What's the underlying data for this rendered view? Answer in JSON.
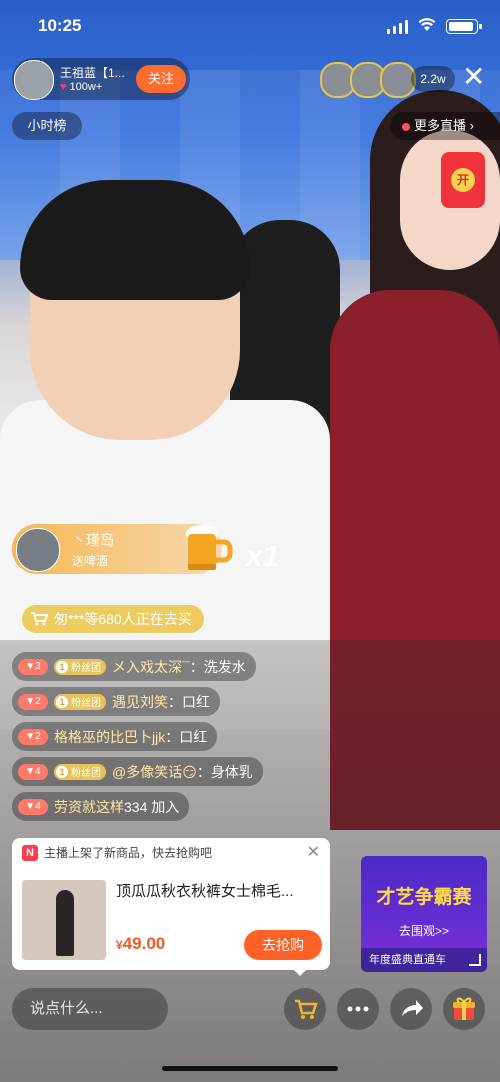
{
  "status": {
    "time": "10:25"
  },
  "host": {
    "name": "王祖蓝【1...",
    "likes": "100w+"
  },
  "follow_label": "关注",
  "viewer_count": "2.2w",
  "hour_rank": "小时榜",
  "more_live": "更多直播",
  "red_packet": "开",
  "gift": {
    "user": "丶瑾岛",
    "desc": "送啤酒",
    "count": "x1"
  },
  "buyers": "匆***等680人正在去买",
  "chat": [
    {
      "level": "3",
      "fan": "粉丝团",
      "user": "メ入戏太深¯",
      "sep": "：",
      "text": "洗发水"
    },
    {
      "level": "2",
      "fan": "粉丝团",
      "user": "遇见刘笑",
      "sep": "：",
      "text": "口红"
    },
    {
      "level": "2",
      "fan": "",
      "user": "格格巫的比巴卜jjk",
      "sep": "：",
      "text": "口红"
    },
    {
      "level": "4",
      "fan": "粉丝团",
      "user": "@多像笑话😏",
      "sep": "：",
      "text": "身体乳"
    },
    {
      "level": "4",
      "fan": "",
      "user": "劳资就这样",
      "sep": " ",
      "text": "334 加入"
    }
  ],
  "product": {
    "header": "主播上架了新商品，快去抢购吧",
    "badge": "N",
    "title": "顶瓜瓜秋衣秋裤女士棉毛...",
    "price_symbol": "¥",
    "price": "49.00",
    "buy": "去抢购"
  },
  "promo": {
    "title": "才艺争霸赛",
    "link": "去围观>>",
    "footer": "年度盛典直通车"
  },
  "input_placeholder": "说点什么...",
  "colors": {
    "accent": "#ff6127",
    "gift": "#f6b044",
    "promo": "#5a2bd0"
  }
}
